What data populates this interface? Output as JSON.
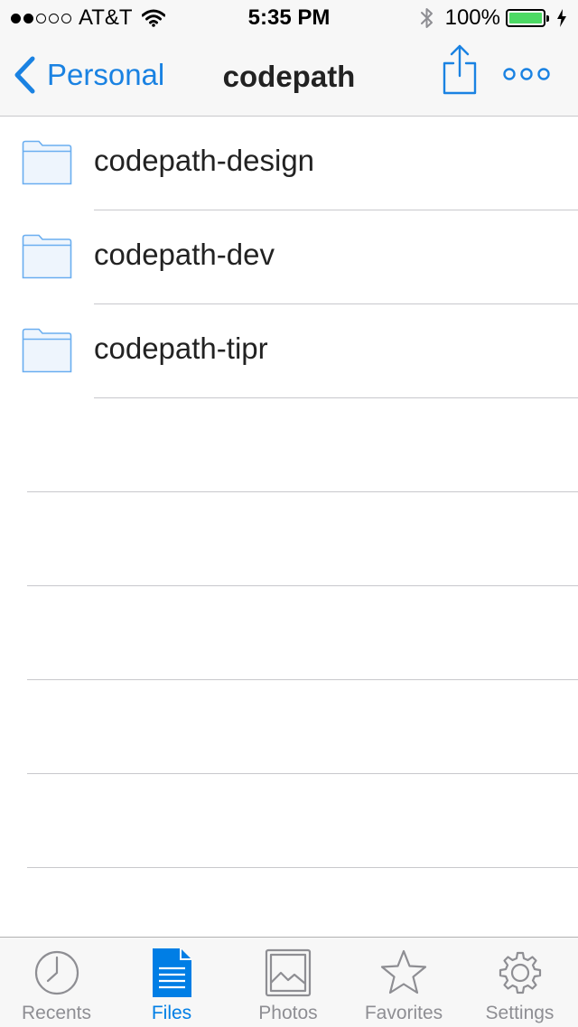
{
  "status_bar": {
    "carrier": "AT&T",
    "signal_bars": 2,
    "signal_total": 5,
    "time": "5:35 PM",
    "battery_percent": "100%",
    "battery_level": 1.0,
    "battery_color": "#4cd964",
    "icons": [
      "wifi-icon",
      "bluetooth-icon",
      "charging-bolt-icon"
    ]
  },
  "colors": {
    "accent": "#007ee5",
    "nav_blue": "#1a82e2",
    "folder_stroke": "#6aaef0",
    "folder_fill": "#eef5fd",
    "tab_inactive": "#8e8e93"
  },
  "nav": {
    "back_label": "Personal",
    "title": "codepath",
    "share_icon": "share-icon",
    "more_icon": "more-icon"
  },
  "folders": [
    {
      "name": "codepath-design",
      "icon": "folder-icon"
    },
    {
      "name": "codepath-dev",
      "icon": "folder-icon"
    },
    {
      "name": "codepath-tipr",
      "icon": "folder-icon"
    }
  ],
  "tabs": [
    {
      "label": "Recents",
      "icon": "clock-icon",
      "active": false
    },
    {
      "label": "Files",
      "icon": "document-icon",
      "active": true
    },
    {
      "label": "Photos",
      "icon": "photo-icon",
      "active": false
    },
    {
      "label": "Favorites",
      "icon": "star-icon",
      "active": false
    },
    {
      "label": "Settings",
      "icon": "gear-icon",
      "active": false
    }
  ]
}
